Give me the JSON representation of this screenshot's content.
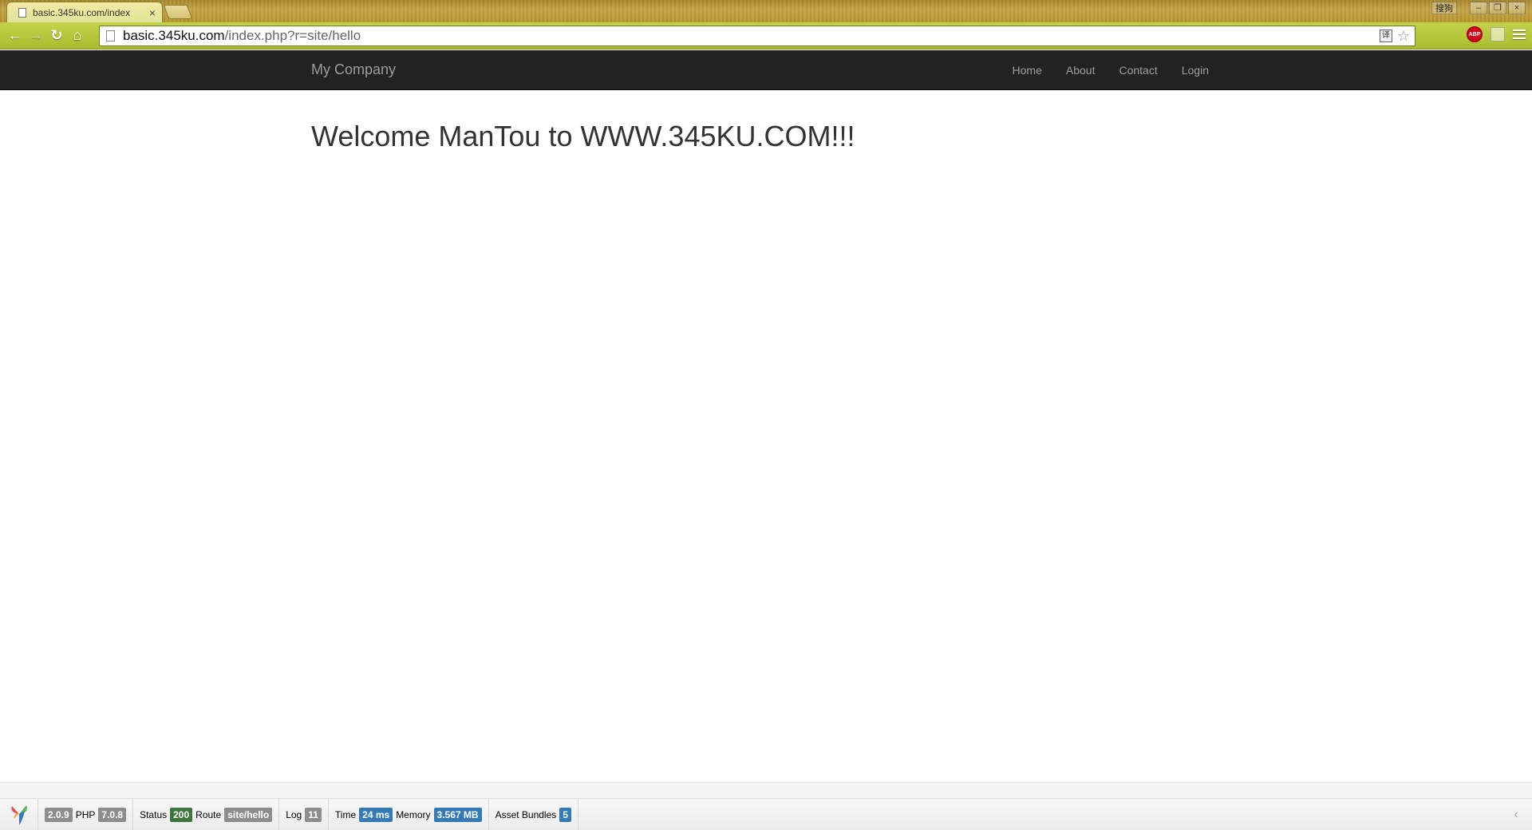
{
  "browser": {
    "tab_title": "basic.345ku.com/index",
    "tab_close": "×",
    "ime_label": "搜狗",
    "window_minimize": "–",
    "window_restore": "❐",
    "window_close": "×",
    "nav_back": "←",
    "nav_forward": "→",
    "nav_reload": "↻",
    "nav_home": "⌂",
    "url_host": "basic.345ku.com",
    "url_path": "/index.php?r=site/hello",
    "translate_glyph": "译",
    "star_glyph": "☆",
    "adblock_label": "ABP"
  },
  "navbar": {
    "brand": "My Company",
    "items": [
      {
        "label": "Home"
      },
      {
        "label": "About"
      },
      {
        "label": "Contact"
      },
      {
        "label": "Login"
      }
    ]
  },
  "main": {
    "heading": "Welcome ManTou to WWW.345KU.COM!!!"
  },
  "debug": {
    "yii_version": "2.0.9",
    "php_label": "PHP",
    "php_version": "7.0.8",
    "status_label": "Status",
    "status_value": "200",
    "route_label": "Route",
    "route_value": "site/hello",
    "log_label": "Log",
    "log_value": "11",
    "time_label": "Time",
    "time_value": "24 ms",
    "memory_label": "Memory",
    "memory_value": "3.567 MB",
    "assets_label": "Asset Bundles",
    "assets_value": "5",
    "collapse_glyph": "‹",
    "colors": {
      "default": "#8d8d8d",
      "success": "#3c763d",
      "info": "#337ab7"
    }
  }
}
